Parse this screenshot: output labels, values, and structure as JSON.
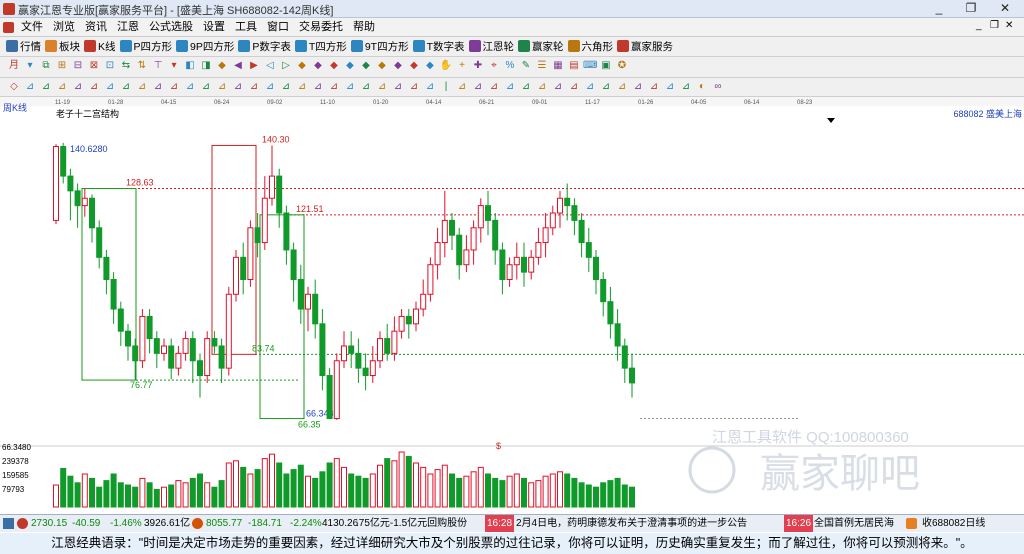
{
  "window": {
    "title": "赢家江恩专业版[赢家服务平台] - [盛美上海  SH688082-142周K线]",
    "controls": [
      "_",
      "❐",
      "✕"
    ],
    "inner_controls": [
      "_",
      "❐",
      "✕"
    ]
  },
  "menu": [
    "文件",
    "浏览",
    "资讯",
    "江恩",
    "公式选股",
    "设置",
    "工具",
    "窗口",
    "交易委托",
    "帮助"
  ],
  "toolbar1": [
    {
      "label": "行情",
      "icon": "grid-icon",
      "color": "#3a6ea5"
    },
    {
      "label": "板块",
      "icon": "blocks-icon",
      "color": "#d9822b"
    },
    {
      "label": "K线",
      "icon": "kline-icon",
      "color": "#c0392b"
    },
    {
      "label": "P四方形",
      "icon": "p-square-icon",
      "color": "#2e86c1"
    },
    {
      "label": "9P四方形",
      "icon": "9p-square-icon",
      "color": "#2e86c1"
    },
    {
      "label": "P数字表",
      "icon": "p-table-icon",
      "color": "#2e86c1"
    },
    {
      "label": "T四方形",
      "icon": "t-square-icon",
      "color": "#2e86c1"
    },
    {
      "label": "9T四方形",
      "icon": "9t-square-icon",
      "color": "#2e86c1"
    },
    {
      "label": "T数字表",
      "icon": "t-table-icon",
      "color": "#2e86c1"
    },
    {
      "label": "江恩轮",
      "icon": "gann-wheel-icon",
      "color": "#7d3c98"
    },
    {
      "label": "赢家轮",
      "icon": "winner-wheel-icon",
      "color": "#1e8449"
    },
    {
      "label": "六角形",
      "icon": "hexagon-icon",
      "color": "#b9770e"
    },
    {
      "label": "赢家服务",
      "icon": "service-icon",
      "color": "#c0392b"
    }
  ],
  "toolbar2_glyphs": [
    "月",
    "▾",
    "⧉",
    "⊞",
    "⊟",
    "⊠",
    "⊡",
    "⇆",
    "⇅",
    "⊤",
    "▾",
    "◧",
    "◨",
    "◆",
    "◀",
    "▶",
    "◁",
    "▷",
    "◆",
    "◆",
    "◆",
    "◆",
    "◆",
    "◆",
    "◆",
    "◆",
    "◆",
    "✋",
    "+",
    "✚",
    "⌖",
    "%",
    "✎",
    "☰",
    "▦",
    "▤",
    "⌨",
    "▣",
    "✪"
  ],
  "toolbar3_glyphs": [
    "◇",
    "⊿",
    "⊿",
    "⊿",
    "⊿",
    "⊿",
    "⊿",
    "⊿",
    "⊿",
    "⊿",
    "⊿",
    "⊿",
    "⊿",
    "⊿",
    "⊿",
    "⊿",
    "⊿",
    "⊿",
    "⊿",
    "⊿",
    "⊿",
    "⊿",
    "⊿",
    "⊿",
    "⊿",
    "⊿",
    "⊿",
    "|",
    "⊿",
    "⊿",
    "⊿",
    "⊿",
    "⊿",
    "⊿",
    "⊿",
    "⊿",
    "⊿",
    "⊿",
    "⊿",
    "⊿",
    "⊿",
    "⊿",
    "⊿",
    "◐",
    "∞"
  ],
  "chart": {
    "period_label": "周K线",
    "stock_code_name": "688082  盛美上海",
    "study_name": "老子十二宫结构",
    "watermark_title": "江恩工具软件  QQ:100800360",
    "watermark_logo_text": "赢家聊吧",
    "date_ticks": [
      "11-19",
      "01-28",
      "04-15",
      "06-24",
      "09-02",
      "11-10",
      "01-20",
      "04-14",
      "06-21",
      "09-01",
      "11-17",
      "01-26",
      "04-05",
      "06-14",
      "08-23"
    ],
    "price_levels": [
      {
        "label": "140.30",
        "color": "#d02020"
      },
      {
        "label": "140.6280",
        "color": "#1f3fbf"
      },
      {
        "label": "128.63",
        "color": "#d02020"
      },
      {
        "label": "121.51",
        "color": "#d02020"
      },
      {
        "label": "83.74",
        "color": "#1a9a1a"
      },
      {
        "label": "76.77",
        "color": "#1a9a1a"
      },
      {
        "label": "66.3480",
        "color": "#1f3fbf"
      },
      {
        "label": "66.35",
        "color": "#1a9a1a"
      }
    ],
    "volume_axis": [
      "66.3480",
      "239378",
      "159585",
      "79793"
    ],
    "marker": "$",
    "up_color": "#e0102a",
    "down_color": "#0f9a2a"
  },
  "chart_data": {
    "type": "candlestick",
    "title": "老子十二宫结构",
    "x_ticks": [
      "11-19",
      "01-28",
      "04-15",
      "06-24",
      "09-02",
      "11-10",
      "01-20",
      "04-14",
      "06-21",
      "09-01",
      "11-17",
      "01-26",
      "04-05",
      "06-14",
      "08-23"
    ],
    "price_ylim": [
      60,
      148
    ],
    "candles": [
      [
        120,
        140,
        140.63,
        119
      ],
      [
        140,
        132,
        141,
        130
      ],
      [
        132,
        128,
        134,
        120
      ],
      [
        128,
        124,
        130,
        118
      ],
      [
        124,
        126,
        128.63,
        121
      ],
      [
        126,
        118,
        127,
        114
      ],
      [
        118,
        110,
        120,
        107
      ],
      [
        110,
        104,
        112,
        100
      ],
      [
        104,
        96,
        106,
        92
      ],
      [
        96,
        90,
        98,
        86
      ],
      [
        90,
        86,
        92,
        82
      ],
      [
        86,
        82,
        88,
        76.77
      ],
      [
        82,
        94,
        96,
        80
      ],
      [
        94,
        88,
        96,
        84
      ],
      [
        88,
        84,
        90,
        80
      ],
      [
        84,
        86,
        88,
        82
      ],
      [
        86,
        80,
        88,
        77
      ],
      [
        80,
        84,
        86,
        78
      ],
      [
        84,
        88,
        90,
        82
      ],
      [
        88,
        82,
        90,
        76
      ],
      [
        82,
        78,
        84,
        72
      ],
      [
        78,
        88,
        90,
        76
      ],
      [
        88,
        86,
        90,
        84
      ],
      [
        86,
        80,
        88,
        76
      ],
      [
        80,
        100,
        102,
        78
      ],
      [
        100,
        110,
        112,
        98
      ],
      [
        110,
        104,
        114,
        100
      ],
      [
        104,
        118,
        120,
        102
      ],
      [
        118,
        114,
        122,
        110
      ],
      [
        114,
        126,
        132,
        112
      ],
      [
        126,
        132,
        140.3,
        124
      ],
      [
        132,
        122,
        134,
        118
      ],
      [
        122,
        112,
        124,
        108
      ],
      [
        112,
        104,
        114,
        98
      ],
      [
        104,
        96,
        108,
        92
      ],
      [
        96,
        100,
        102,
        90
      ],
      [
        100,
        92,
        104,
        88
      ],
      [
        92,
        78,
        96,
        74
      ],
      [
        78,
        66.35,
        80,
        66.348
      ],
      [
        66.35,
        82,
        84,
        66
      ],
      [
        82,
        86,
        90,
        80
      ],
      [
        86,
        84,
        90,
        80
      ],
      [
        84,
        80,
        88,
        76
      ],
      [
        80,
        78,
        84,
        74
      ],
      [
        78,
        82,
        86,
        76
      ],
      [
        82,
        88,
        90,
        80
      ],
      [
        88,
        84,
        92,
        82
      ],
      [
        84,
        90,
        94,
        82
      ],
      [
        90,
        94,
        96,
        88
      ],
      [
        94,
        92,
        96,
        88
      ],
      [
        92,
        96,
        98,
        90
      ],
      [
        96,
        100,
        104,
        94
      ],
      [
        100,
        108,
        110,
        98
      ],
      [
        108,
        114,
        118,
        104
      ],
      [
        114,
        120,
        128,
        110
      ],
      [
        120,
        116,
        122,
        112
      ],
      [
        116,
        108,
        118,
        104
      ],
      [
        108,
        112,
        116,
        106
      ],
      [
        112,
        118,
        120,
        108
      ],
      [
        118,
        124,
        126,
        114
      ],
      [
        124,
        120,
        128,
        116
      ],
      [
        120,
        112,
        122,
        108
      ],
      [
        112,
        104,
        114,
        100
      ],
      [
        104,
        108,
        110,
        102
      ],
      [
        108,
        110,
        114,
        104
      ],
      [
        110,
        106,
        114,
        102
      ],
      [
        106,
        110,
        112,
        104
      ],
      [
        110,
        114,
        118,
        108
      ],
      [
        114,
        118,
        122,
        110
      ],
      [
        118,
        122,
        124,
        116
      ],
      [
        122,
        126,
        128,
        118
      ],
      [
        126,
        124,
        130,
        120
      ],
      [
        124,
        120,
        126,
        116
      ],
      [
        120,
        114,
        122,
        110
      ],
      [
        114,
        110,
        118,
        106
      ],
      [
        110,
        104,
        112,
        100
      ],
      [
        104,
        98,
        106,
        94
      ],
      [
        98,
        92,
        102,
        88
      ],
      [
        92,
        86,
        96,
        82
      ],
      [
        86,
        80,
        88,
        76
      ],
      [
        80,
        76,
        84,
        72
      ]
    ],
    "volume": [
      20,
      35,
      28,
      22,
      30,
      26,
      18,
      24,
      30,
      22,
      20,
      18,
      26,
      22,
      16,
      18,
      20,
      24,
      22,
      26,
      30,
      22,
      18,
      24,
      40,
      42,
      36,
      30,
      34,
      44,
      48,
      40,
      30,
      34,
      38,
      28,
      26,
      32,
      40,
      44,
      36,
      30,
      28,
      26,
      30,
      38,
      44,
      42,
      50,
      46,
      40,
      36,
      30,
      34,
      38,
      30,
      26,
      28,
      32,
      36,
      30,
      26,
      24,
      28,
      30,
      26,
      22,
      24,
      28,
      30,
      32,
      30,
      26,
      22,
      20,
      18,
      22,
      24,
      26,
      20,
      18
    ]
  },
  "statusbar": {
    "sh_index": "2730.15",
    "sh_change": "-40.59",
    "sh_pct": "-1.46%",
    "sh_amount": "3926.61亿",
    "sz_index": "8055.77",
    "sz_change": "-184.71",
    "sz_pct": "-2.24%",
    "sz_amount": "4130.26",
    "ticker_text": ".75亿元-1.5亿元回购股份",
    "news_time1": "16:28",
    "news_text1": "2月4日电，药明康德发布关于澄清事项的进一步公告",
    "news_time2": "16:26",
    "news_text2": "全国首例无居民海",
    "right_text": "收688082日线"
  },
  "quote": "江恩经典语录：\"时间是决定市场走势的重要因素，经过详细研究大市及个别股票的过往记录，你将可以证明，历史确实重复发生；而了解过往，你将可以预测将来。\"。"
}
